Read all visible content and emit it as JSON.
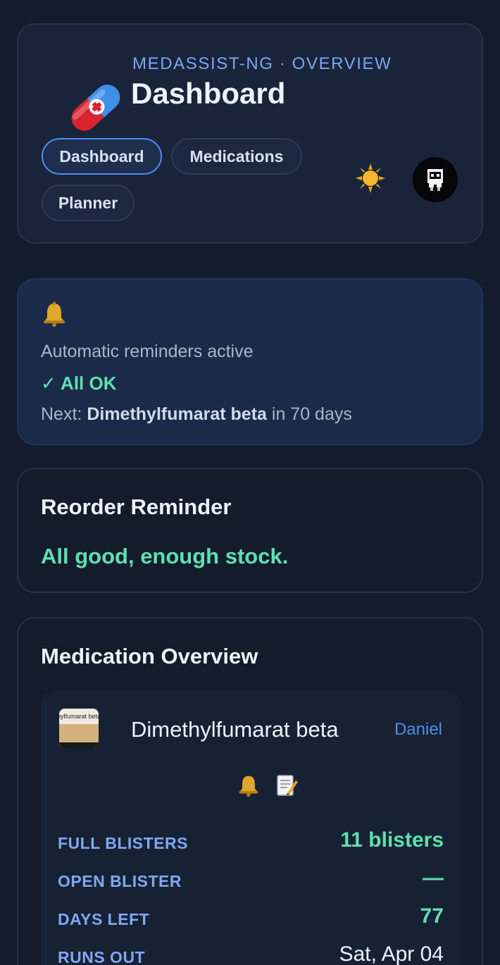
{
  "header": {
    "eyebrow": "MEDASSIST-NG · OVERVIEW",
    "title": "Dashboard",
    "tabs": [
      {
        "label": "Dashboard",
        "active": true
      },
      {
        "label": "Medications",
        "active": false
      },
      {
        "label": "Planner",
        "active": false
      }
    ],
    "icons": {
      "logo": "pill-icon",
      "theme": "sun-icon",
      "avatar": "robot-avatar-icon"
    }
  },
  "reminders": {
    "icon": "bell-icon",
    "status_text": "Automatic reminders active",
    "ok_text": "✓ All OK",
    "next_prefix": "Next:",
    "next_med": "Dimethylfumarat beta",
    "next_suffix": "in 70 days"
  },
  "reorder": {
    "title": "Reorder Reminder",
    "status": "All good, enough stock."
  },
  "overview": {
    "title": "Medication Overview",
    "items": [
      {
        "name": "Dimethylfumarat beta",
        "owner": "Daniel",
        "thumb_text": "hylfumarat beta",
        "stats": [
          {
            "label": "FULL BLISTERS",
            "value": "11 blisters"
          },
          {
            "label": "OPEN BLISTER",
            "value": "—"
          },
          {
            "label": "DAYS LEFT",
            "value": "77"
          },
          {
            "label": "RUNS OUT",
            "value": "Sat, Apr 04"
          }
        ]
      }
    ]
  },
  "colors": {
    "background": "#131c2e",
    "accent": "#4f8df3",
    "success": "#5ee0b0",
    "label": "#7fa8f0"
  }
}
